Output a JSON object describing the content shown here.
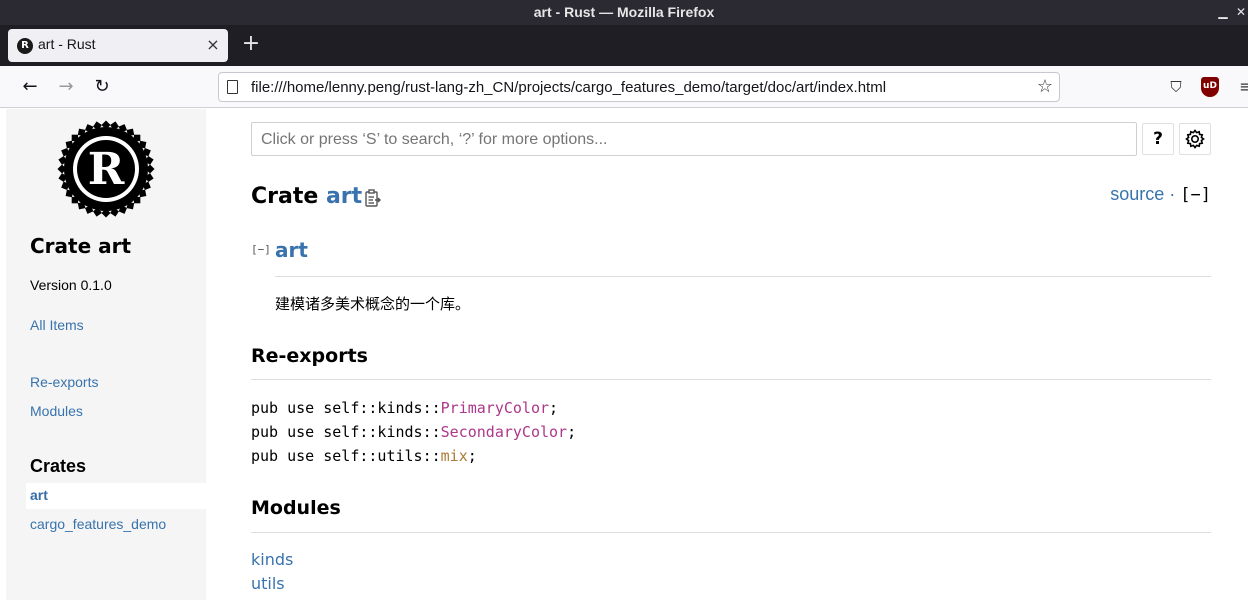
{
  "window": {
    "title": "art - Rust — Mozilla Firefox",
    "minimize_glyph": "▁",
    "close_glyph": "✕"
  },
  "tabs": [
    {
      "label": "art - Rust",
      "favicon": "R",
      "close_glyph": "×"
    }
  ],
  "newtab_glyph": "+",
  "nav": {
    "back_glyph": "←",
    "forward_glyph": "→",
    "reload_glyph": "↻",
    "url": "file:///home/lenny.peng/rust-lang-zh_CN/projects/cargo_features_demo/target/doc/art/index.html",
    "star_glyph": "☆",
    "ublock_label": "uD",
    "pocket_glyph": "⛉",
    "menu_glyph": "≡"
  },
  "sidebar": {
    "crate_title": "Crate art",
    "version": "Version 0.1.0",
    "all_items": "All Items",
    "section_links": [
      "Re-exports",
      "Modules"
    ],
    "crates_heading": "Crates",
    "crates": [
      "art",
      "cargo_features_demo"
    ],
    "logo_letter": "R"
  },
  "main": {
    "search_placeholder": "Click or press ‘S’ to search, ‘?’ for more options...",
    "help_label": "?",
    "heading_prefix": "Crate",
    "crate_name": "art",
    "source_label": "source",
    "separator": " · ",
    "collapse_label": "[−]",
    "doc_toggle": "[−]",
    "doc_title": "art",
    "doc_text": "建模诸多美术概念的一个库。",
    "reexports_heading": "Re-exports",
    "reexports": [
      {
        "prefix": "pub use self::kinds::",
        "name": "PrimaryColor",
        "suffix": ";",
        "kind": "enum"
      },
      {
        "prefix": "pub use self::kinds::",
        "name": "SecondaryColor",
        "suffix": ";",
        "kind": "enum"
      },
      {
        "prefix": "pub use self::utils::",
        "name": "mix",
        "suffix": ";",
        "kind": "fn"
      }
    ],
    "modules_heading": "Modules",
    "modules": [
      "kinds",
      "utils"
    ]
  },
  "colors": {
    "link": "#3873ad",
    "enum": "#ad378a",
    "fn": "#ad7c37"
  },
  "icons": [
    "rust-logo-icon",
    "copy-path-icon",
    "settings-gear-icon",
    "page-icon",
    "bookmark-star-icon",
    "pocket-icon",
    "ublock-icon",
    "hamburger-menu-icon",
    "back-arrow-icon",
    "forward-arrow-icon",
    "reload-icon",
    "close-tab-icon",
    "new-tab-icon"
  ]
}
